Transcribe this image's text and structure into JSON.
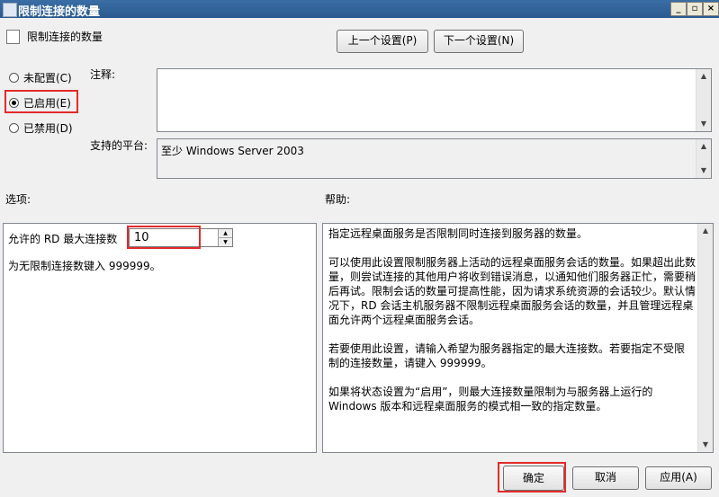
{
  "window": {
    "title": "限制连接的数量",
    "controls": [
      "_",
      "▫",
      "×"
    ]
  },
  "header": {
    "policy_name": "限制连接的数量",
    "prev_button": "上一个设置(P)",
    "next_button": "下一个设置(N)"
  },
  "state": {
    "options": [
      {
        "label": "未配置(C)",
        "selected": false
      },
      {
        "label": "已启用(E)",
        "selected": true
      },
      {
        "label": "已禁用(D)",
        "selected": false
      }
    ]
  },
  "comment": {
    "label": "注释:",
    "value": ""
  },
  "platform": {
    "label": "支持的平台:",
    "value": "至少 Windows Server 2003"
  },
  "options_panel": {
    "heading": "选项:",
    "max_label": "允许的 RD 最大连接数",
    "max_value": "10",
    "hint": "为无限制连接数键入 999999。"
  },
  "help_panel": {
    "heading": "帮助:",
    "lines": [
      "指定远程桌面服务是否限制同时连接到服务器的数量。",
      "",
      "可以使用此设置限制服务器上活动的远程桌面服务会话的数量。如果超出此数",
      "量，则尝试连接的其他用户将收到错误消息，以通知他们服务器正忙，需要稍",
      "后再试。限制会话的数量可提高性能，因为请求系统资源的会话较少。默认情",
      "况下，RD 会话主机服务器不限制远程桌面服务会话的数量，并且管理远程桌",
      "面允许两个远程桌面服务会话。",
      "",
      "若要使用此设置，请输入希望为服务器指定的最大连接数。若要指定不受限",
      "制的连接数量，请键入 999999。",
      "",
      "如果将状态设置为“启用”，则最大连接数量限制为与服务器上运行的",
      "Windows 版本和远程桌面服务的模式相一致的指定数量。"
    ]
  },
  "footer": {
    "ok_button": "确定",
    "cancel_button": "取消",
    "apply_button": "应用(A)"
  }
}
